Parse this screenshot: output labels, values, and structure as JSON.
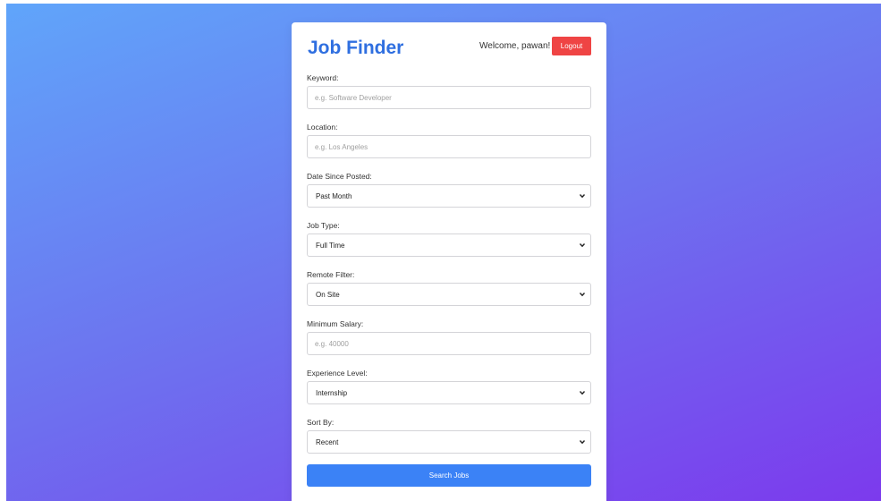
{
  "header": {
    "title": "Job Finder",
    "welcome": "Welcome, pawan!",
    "logout_label": "Logout"
  },
  "form": {
    "keyword": {
      "label": "Keyword:",
      "placeholder": "e.g. Software Developer",
      "value": ""
    },
    "location": {
      "label": "Location:",
      "placeholder": "e.g. Los Angeles",
      "value": ""
    },
    "date_since_posted": {
      "label": "Date Since Posted:",
      "selected": "Past Month"
    },
    "job_type": {
      "label": "Job Type:",
      "selected": "Full Time"
    },
    "remote_filter": {
      "label": "Remote Filter:",
      "selected": "On Site"
    },
    "minimum_salary": {
      "label": "Minimum Salary:",
      "placeholder": "e.g. 40000",
      "value": ""
    },
    "experience_level": {
      "label": "Experience Level:",
      "selected": "Internship"
    },
    "sort_by": {
      "label": "Sort By:",
      "selected": "Recent"
    },
    "submit_label": "Search Jobs"
  },
  "colors": {
    "title": "#2f6fe0",
    "logout": "#ef4444",
    "primary_button": "#3b82f6",
    "gradient_start": "#60a5fa",
    "gradient_end": "#7c3aed"
  },
  "icons": {
    "select_arrow": "chevron-down-icon"
  }
}
